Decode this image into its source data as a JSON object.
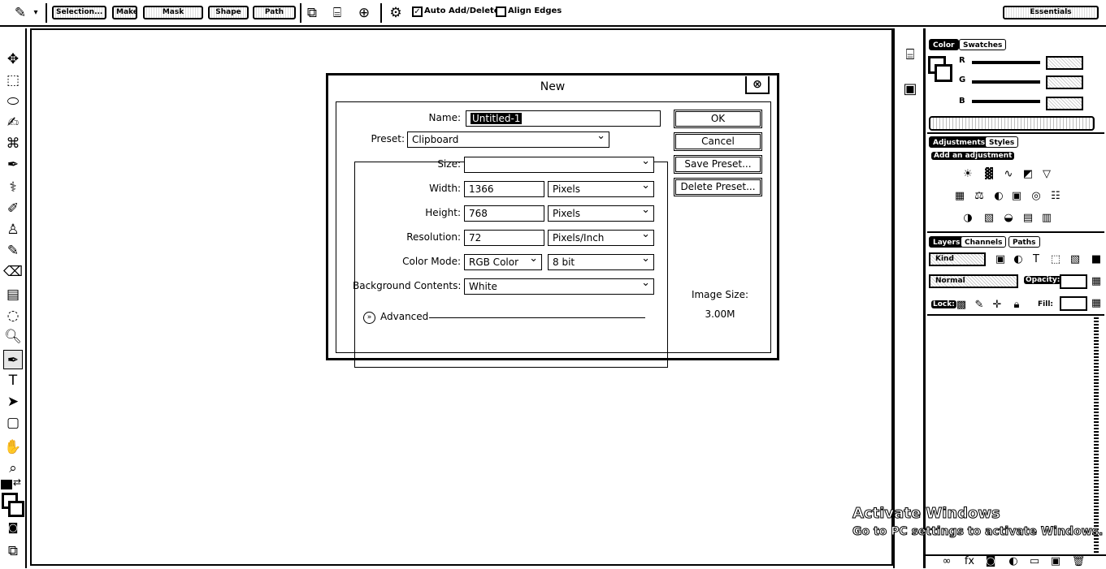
{
  "options_bar": {
    "tool_icon": "pen-icon",
    "buttons": [
      "Selection...",
      "Make",
      "Mask",
      "Shape",
      "Path"
    ],
    "path_ops": [
      "combine-icon",
      "subtract-icon",
      "intersect-icon"
    ],
    "settings_icon": "gear-icon",
    "auto_add_delete": {
      "label": "Auto Add/Delete",
      "checked": true
    },
    "align_edges": {
      "label": "Align Edges",
      "checked": false
    },
    "workspace_label": "Essentials"
  },
  "toolbox": {
    "tools": [
      "move-icon",
      "marquee-icon",
      "lasso-icon",
      "quick-select-icon",
      "crop-icon",
      "eyedropper-icon",
      "healing-icon",
      "brush-icon",
      "stamp-icon",
      "history-brush-icon",
      "eraser-icon",
      "gradient-icon",
      "blur-icon",
      "dodge-icon",
      "pen-icon",
      "type-icon",
      "path-select-icon",
      "shape-icon",
      "hand-icon",
      "zoom-icon"
    ],
    "active_tool": "pen-icon"
  },
  "dialog": {
    "title": "New",
    "name_label": "Name:",
    "name_value": "Untitled-1",
    "preset_label": "Preset:",
    "preset_value": "Clipboard",
    "size_label": "Size:",
    "size_value": "",
    "width_label": "Width:",
    "width_value": "1366",
    "width_unit": "Pixels",
    "height_label": "Height:",
    "height_value": "768",
    "height_unit": "Pixels",
    "resolution_label": "Resolution:",
    "resolution_value": "72",
    "resolution_unit": "Pixels/Inch",
    "color_mode_label": "Color Mode:",
    "color_mode_value": "RGB Color",
    "bit_depth_value": "8 bit",
    "background_label": "Background Contents:",
    "background_value": "White",
    "advanced_label": "Advanced",
    "ok_label": "OK",
    "cancel_label": "Cancel",
    "save_preset_label": "Save Preset...",
    "delete_preset_label": "Delete Preset...",
    "image_size_label": "Image Size:",
    "image_size_value": "3.00M"
  },
  "color_panel": {
    "tabs": [
      "Color",
      "Swatches"
    ],
    "channels": [
      "R",
      "G",
      "B"
    ]
  },
  "adjustments_panel": {
    "tabs": [
      "Adjustments",
      "Styles"
    ],
    "heading": "Add an adjustment"
  },
  "layers_panel": {
    "tabs": [
      "Layers",
      "Channels",
      "Paths"
    ],
    "kind_label": "Kind",
    "blend_mode": "Normal",
    "opacity_label": "Opacity:",
    "lock_label": "Lock:",
    "fill_label": "Fill:"
  },
  "watermark": {
    "line1": "Activate Windows",
    "line2": "Go to PC settings to activate Windows."
  }
}
